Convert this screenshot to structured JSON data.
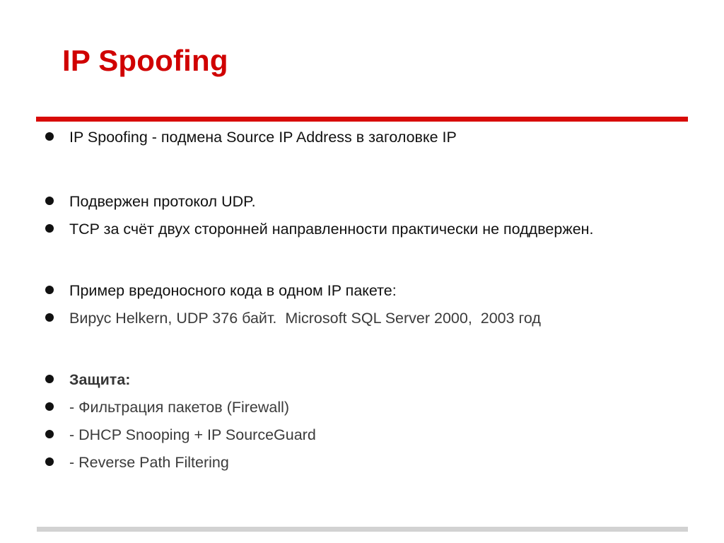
{
  "slide": {
    "title": "IP Spoofing",
    "title_color": "#d00000",
    "rule_color": "#d80b07",
    "footer_rule_color": "#d2d2d2",
    "bullet_glyph": "bullet-dot",
    "bullets": [
      {
        "id": "b1",
        "text": "IP Spoofing - подмена Source IP Address в заголовке IP",
        "style": "black",
        "bold": false
      },
      {
        "id": "b2",
        "text": "Подвержен протокол UDP.",
        "style": "black",
        "bold": false
      },
      {
        "id": "b3",
        "text": "TCP за счёт двух сторонней направленности практически не поддвержен.",
        "style": "black",
        "bold": false
      },
      {
        "id": "b4",
        "text": "Пример вредоносного кода в одном IP пакете:",
        "style": "black",
        "bold": false
      },
      {
        "id": "b5",
        "text": "Вирус Helkern, UDP 376 байт.  Microsoft SQL Server 2000,  2003 год",
        "style": "grey",
        "bold": false
      },
      {
        "id": "b6",
        "text": "Защита:",
        "style": "grey",
        "bold": true
      },
      {
        "id": "b7",
        "text": "- Фильтрация пакетов (Firewall)",
        "style": "grey",
        "bold": false
      },
      {
        "id": "b8",
        "text": "- DHCP Snooping + IP SourceGuard",
        "style": "grey",
        "bold": false
      },
      {
        "id": "b9",
        "text": "- Reverse Path Filtering",
        "style": "grey",
        "bold": false
      }
    ]
  }
}
